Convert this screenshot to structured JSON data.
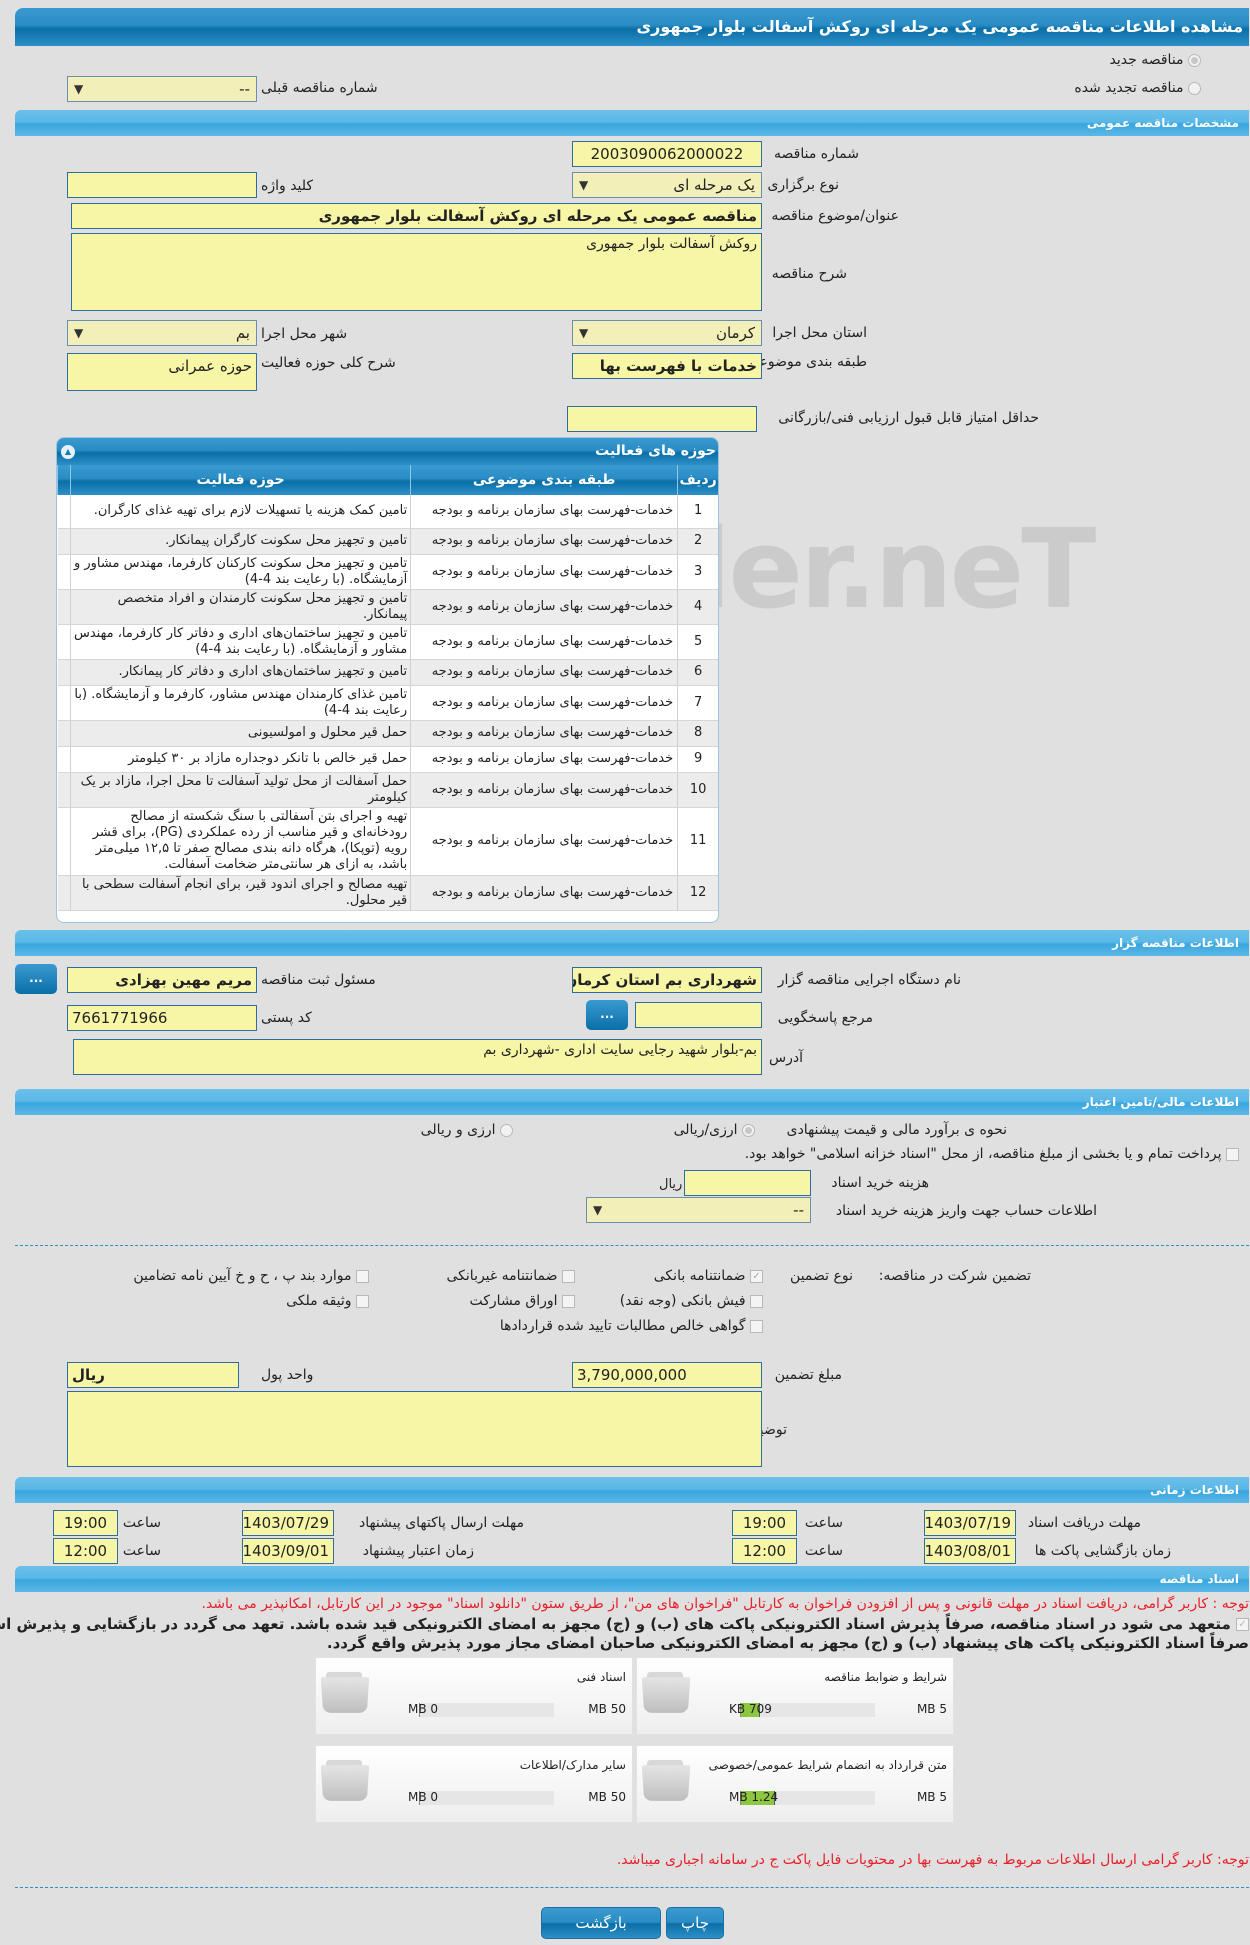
{
  "page": {
    "title": "مشاهده اطلاعات مناقصه عمومی یک مرحله ای روکش آسفالت بلوار جمهوری"
  },
  "tender_type": {
    "new_label": "مناقصه جدید",
    "renewed_label": "مناقصه تجدید شده",
    "new_selected": true,
    "previous_number_label": "شماره مناقصه قبلی",
    "previous_number_value": "--"
  },
  "general": {
    "section_title": "مشخصات مناقصه عمومی",
    "tender_number_label": "شماره مناقصه",
    "tender_number": "2003090062000022",
    "holding_type_label": "نوع برگزاری",
    "holding_type": "یک مرحله ای",
    "keyword_label": "کلید واژه",
    "keyword": "",
    "subject_label": "عنوان/موضوع مناقصه",
    "subject": "مناقصه عمومی یک مرحله ای روکش آسفالت بلوار جمهوری",
    "description_label": "شرح مناقصه",
    "description": "روکش آسفالت بلوار جمهوری",
    "province_label": "استان محل اجرا",
    "province": "کرمان",
    "city_label": "شهر محل اجرا",
    "city": "بم",
    "category_label": "طبقه بندی موضوعی",
    "category": "خدمات با فهرست بها",
    "activity_scope_label": "شرح کلی حوزه فعالیت",
    "activity_scope": "حوزه عمرانی",
    "min_score_label": "حداقل امتیاز قابل قبول ارزیابی فنی/بازرگانی",
    "min_score": ""
  },
  "activities": {
    "title": "حوزه های فعالیت",
    "columns": [
      "ردیف",
      "طبقه بندی موضوعی",
      "حوزه فعالیت"
    ],
    "rows": [
      {
        "n": "1",
        "category": "خدمات-فهرست بهای سازمان برنامه و بودجه",
        "activity": "تامین کمک هزینه یا تسهیلات لازم برای تهیه غذای کارگران."
      },
      {
        "n": "2",
        "category": "خدمات-فهرست بهای سازمان برنامه و بودجه",
        "activity": "تامین و تجهیز محل سکونت کارگران پیمانکار."
      },
      {
        "n": "3",
        "category": "خدمات-فهرست بهای سازمان برنامه و بودجه",
        "activity": "تامین و تجهیز محل سکونت کارکنان کارفرما، مهندس مشاور و آزمایشگاه. (با رعایت بند 4-4)"
      },
      {
        "n": "4",
        "category": "خدمات-فهرست بهای سازمان برنامه و بودجه",
        "activity": "تامین و تجهیز محل سکونت کارمندان و افراد متخصص پیمانکار."
      },
      {
        "n": "5",
        "category": "خدمات-فهرست بهای سازمان برنامه و بودجه",
        "activity": "تامین و تجهیز ساختمان‌های اداری و دفاتر کار کارفرما، مهندس مشاور و آزمایشگاه. (با رعایت بند 4-4)"
      },
      {
        "n": "6",
        "category": "خدمات-فهرست بهای سازمان برنامه و بودجه",
        "activity": "تامین و تجهیز ساختمان‌های اداری و دفاتر کار پیمانکار."
      },
      {
        "n": "7",
        "category": "خدمات-فهرست بهای سازمان برنامه و بودجه",
        "activity": "تامین غذای کارمندان مهندس مشاور، کارفرما و آزمایشگاه. (با رعایت بند 4-4)"
      },
      {
        "n": "8",
        "category": "خدمات-فهرست بهای سازمان برنامه و بودجه",
        "activity": "حمل قیر محلول و امولسیونی"
      },
      {
        "n": "9",
        "category": "خدمات-فهرست بهای سازمان برنامه و بودجه",
        "activity": "حمل قیر خالص با تانکر دوجداره مازاد بر ۳۰ کیلومتر"
      },
      {
        "n": "10",
        "category": "خدمات-فهرست بهای سازمان برنامه و بودجه",
        "activity": "حمل آسفالت از محل تولید آسفالت تا محل اجرا، مازاد بر یک کیلومتر"
      },
      {
        "n": "11",
        "category": "خدمات-فهرست بهای سازمان برنامه و بودجه",
        "activity": "تهیه و اجرای بتن آسفالتی با سنگ شکسته از مصالح رودخانه‌ای و قیر مناسب از رده عملکردی (PG)، برای قشر رویه (توپکا)، هرگاه دانه بندی مصالح صفر تا ۱۲,۵ میلی‌متر باشد، به ازای هر سانتی‌متر ضخامت آسفالت."
      },
      {
        "n": "12",
        "category": "خدمات-فهرست بهای سازمان برنامه و بودجه",
        "activity": "تهیه مصالح و اجرای اندود قیر، برای انجام آسفالت سطحی با قیر محلول."
      }
    ]
  },
  "organizer": {
    "section_title": "اطلاعات مناقصه گزار",
    "org_name_label": "نام دستگاه اجرایی مناقصه گزار",
    "org_name": "شهرداری بم استان کرمان",
    "registrar_label": "مسئول ثبت مناقصه",
    "registrar": "مریم  مهین بهزادی",
    "reference_label": "مرجع پاسخگویی",
    "reference": "",
    "postal_code_label": "کد پستی",
    "postal_code": "7661771966",
    "address_label": "آدرس",
    "address": "بم-بلوار شهید رجایی سایت اداری -شهرداری بم",
    "dots_label": "..."
  },
  "financial": {
    "section_title": "اطلاعات مالی/تامین اعتبار",
    "estimate_method_label": "نحوه ی برآورد مالی و قیمت پیشنهادی",
    "option_rial": "ارزی/ریالی",
    "option_currency_rial": "ارزی و ریالی",
    "islamic_treasury_text": "پرداخت تمام و یا بخشی از مبلغ مناقصه، از محل \"اسناد خزانه اسلامی\" خواهد بود.",
    "doc_cost_label": "هزینه خرید اسناد",
    "doc_cost": "",
    "doc_cost_unit": "ریال",
    "account_label": "اطلاعات حساب جهت واریز هزینه خرید اسناد",
    "account_value": "--"
  },
  "guarantee": {
    "label": "تضمین شرکت در مناقصه:",
    "type_label": "نوع تضمین",
    "options": [
      {
        "label": "ضمانتنامه بانکی",
        "checked": true
      },
      {
        "label": "ضمانتنامه غیربانکی",
        "checked": false
      },
      {
        "label": "موارد بند پ ، ح و خ آیین نامه تضامین",
        "checked": false
      },
      {
        "label": "فیش بانکی (وجه نقد)",
        "checked": false
      },
      {
        "label": "اوراق مشارکت",
        "checked": false
      },
      {
        "label": "وثیقه ملکی",
        "checked": false
      },
      {
        "label": "گواهی خالص مطالبات تایید شده قراردادها",
        "checked": false
      }
    ],
    "amount_label": "مبلغ تضمین",
    "amount": "3,790,000,000",
    "currency_label": "واحد پول",
    "currency": "ریال",
    "notes_label": "توضیحات",
    "notes": ""
  },
  "timing": {
    "section_title": "اطلاعات زمانی",
    "doc_deadline_label": "مهلت دریافت اسناد",
    "doc_deadline_date": "1403/07/19",
    "doc_deadline_time": "19:00",
    "submit_deadline_label": "مهلت ارسال پاکتهای پیشنهاد",
    "submit_deadline_date": "1403/07/29",
    "submit_deadline_time": "19:00",
    "opening_label": "زمان بازگشایی پاکت ها",
    "opening_date": "1403/08/01",
    "opening_time": "12:00",
    "validity_label": "زمان اعتبار پیشنهاد",
    "validity_date": "1403/09/01",
    "validity_time": "12:00",
    "time_label": "ساعت"
  },
  "documents": {
    "section_title": "اسناد مناقصه",
    "notice": "توجه : کاربر گرامی، دریافت اسناد در مهلت قانونی و پس از افزودن فراخوان به کارتابل \"فراخوان های من\"، از طریق ستون \"دانلود اسناد\" موجود در این کارتابل، امکانپذیر می باشد.",
    "commitment_line1": "متعهد می شود در اسناد مناقصه، صرفاً پذیرش اسناد الکترونیکی پاکت های (ب) و (ج) مجهز به امضای الکترونیکی قید شده باشد. تعهد می گردد در بازگشایی و پذیرش اسناد،",
    "commitment_line2": "صرفاً اسناد الکترونیکی پاکت های پیشنهاد (ب) و (ج) مجهز به امضای الکترونیکی صاحبان امضای مجاز مورد پذیرش واقع گردد.",
    "commitment_checked": true,
    "files": [
      {
        "name": "شرایط و ضوابط مناقصه",
        "current": "709 KB",
        "max": "5 MB",
        "fill_fraction": 0.14
      },
      {
        "name": "اسناد فنی",
        "current": "0 MB",
        "max": "50 MB",
        "fill_fraction": 0
      },
      {
        "name": "متن قرارداد به انضمام شرایط عمومی/خصوصی",
        "current": "1.24 MB",
        "max": "5 MB",
        "fill_fraction": 0.25
      },
      {
        "name": "سایر مدارک/اطلاعات",
        "current": "0 MB",
        "max": "50 MB",
        "fill_fraction": 0
      }
    ],
    "bottom_notice": "توجه: کاربر گرامی ارسال اطلاعات مربوط به فهرست بها در محتویات فایل پاکت ج در سامانه اجباری میباشد."
  },
  "buttons": {
    "print": "چاپ",
    "back": "بازگشت"
  },
  "watermark": "AriaTender.neT"
}
